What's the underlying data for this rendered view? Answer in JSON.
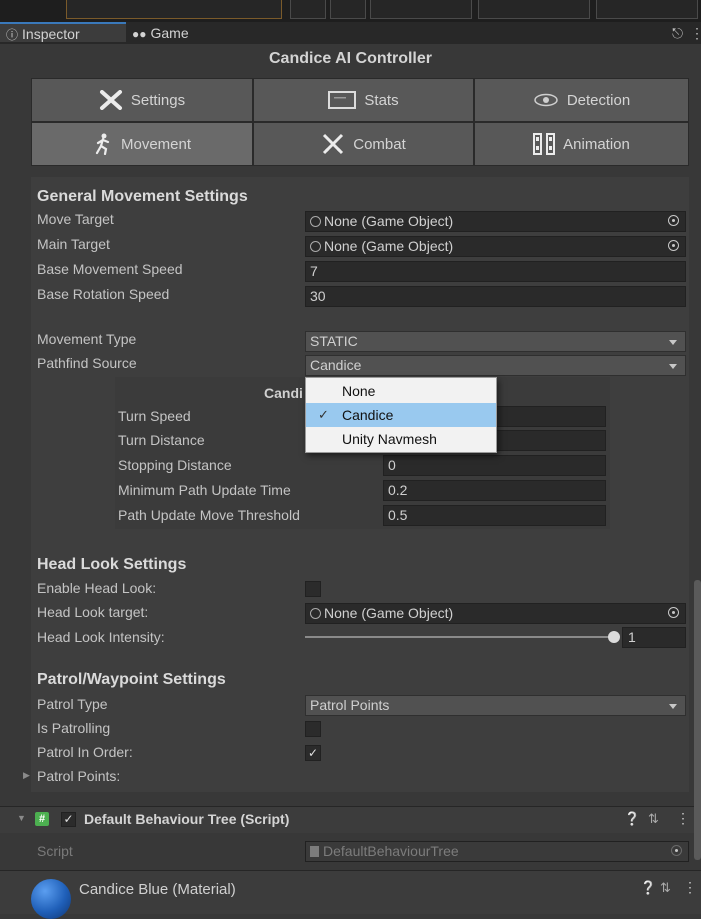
{
  "tabs": {
    "inspector": "Inspector",
    "game": "Game"
  },
  "title": "Candice AI Controller",
  "categories": [
    {
      "label": "Settings",
      "icon": "wrench-cross-icon"
    },
    {
      "label": "Stats",
      "icon": "monitor-icon"
    },
    {
      "label": "Detection",
      "icon": "eye-icon"
    },
    {
      "label": "Movement",
      "icon": "running-person-icon",
      "selected": true
    },
    {
      "label": "Combat",
      "icon": "crossed-swords-icon"
    },
    {
      "label": "Animation",
      "icon": "film-strip-icon"
    }
  ],
  "general_movement": {
    "header": "General Movement Settings",
    "move_target_label": "Move Target",
    "move_target_value": "None (Game Object)",
    "main_target_label": "Main Target",
    "main_target_value": "None (Game Object)",
    "base_speed_label": "Base Movement Speed",
    "base_speed_value": "7",
    "base_rotation_label": "Base Rotation Speed",
    "base_rotation_value": "30",
    "movement_type_label": "Movement Type",
    "movement_type_value": "STATIC",
    "pathfind_source_label": "Pathfind Source",
    "pathfind_source_value": "Candice"
  },
  "candice_panel": {
    "header": "Candi",
    "turn_speed_label": "Turn Speed",
    "turn_distance_label": "Turn Distance",
    "stopping_distance_label": "Stopping Distance",
    "stopping_distance_value": "0",
    "min_path_update_label": "Minimum Path Update Time",
    "min_path_update_value": "0.2",
    "path_threshold_label": "Path Update Move Threshold",
    "path_threshold_value": "0.5"
  },
  "pathfind_dropdown": {
    "options": [
      "None",
      "Candice",
      "Unity Navmesh"
    ],
    "selected": "Candice"
  },
  "head_look": {
    "header": "Head Look Settings",
    "enable_label": "Enable Head Look:",
    "enable_checked": false,
    "target_label": "Head Look target:",
    "target_value": "None (Game Object)",
    "intensity_label": "Head Look Intensity:",
    "intensity_value": "1",
    "intensity_fraction": 1.0
  },
  "patrol": {
    "header": "Patrol/Waypoint Settings",
    "type_label": "Patrol Type",
    "type_value": "Patrol Points",
    "is_patrolling_label": "Is Patrolling",
    "is_patrolling_checked": false,
    "in_order_label": "Patrol In Order:",
    "in_order_checked": true,
    "points_label": "Patrol Points:"
  },
  "behaviour_tree": {
    "title": "Default Behaviour Tree (Script)",
    "script_label": "Script",
    "script_value": "DefaultBehaviourTree"
  },
  "material": {
    "title": "Candice Blue (Material)"
  },
  "check_glyph": "✓",
  "colors": {
    "accent": "#3a79bb",
    "popup_selected": "#99c9ef",
    "material_sphere": "#1f5fb8"
  }
}
